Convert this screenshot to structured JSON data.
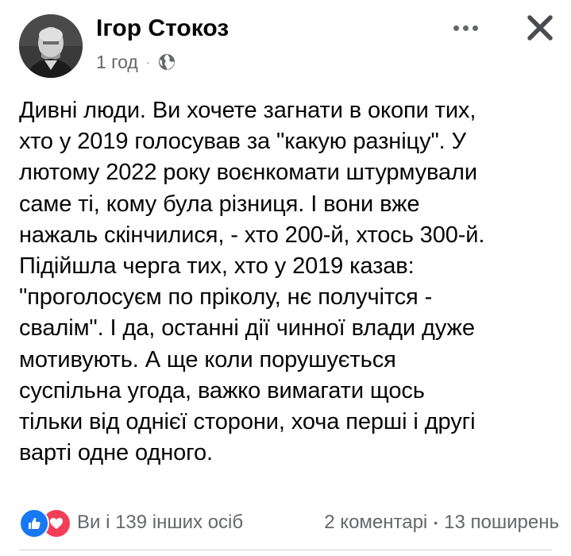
{
  "post": {
    "author_name": "Ігор Стокоз",
    "time": "1 год",
    "separator": "·",
    "privacy_icon": "globe-icon",
    "more_icon": "more-dots-icon",
    "close_icon": "close-icon",
    "text": "Дивні люди. Ви хочете загнати в окопи тих,\nхто у 2019 голосував за \"какую разніцу\". У\nлютому 2022 року воєнкомати штурмували\nсаме ті, кому була різниця. І вони вже\nнажаль скінчилися, - хто 200-й, хтось 300-й.\nПідійшла черга тих, хто у 2019 казав:\n\"проголосуєм по пріколу, нє получітся -\nсвалім\". І да, останні дії чинної влади дуже\nмотивують. А ще коли порушується\nсуспільна угода, важко вимагати щось\nтільки від однієї сторони, хоча перші  і другі\nварті одне одного."
  },
  "footer": {
    "reaction_icons": [
      "like-icon",
      "love-icon"
    ],
    "reaction_count": "Ви і 139 інших осіб",
    "comments": "2 коментарі",
    "separator": "•",
    "shares": "13 поширень"
  },
  "colors": {
    "primary_text": "#050505",
    "secondary_text": "#65676b",
    "like_blue": "#1877f2",
    "love_red": "#f33e58",
    "divider": "#ced0d4"
  }
}
